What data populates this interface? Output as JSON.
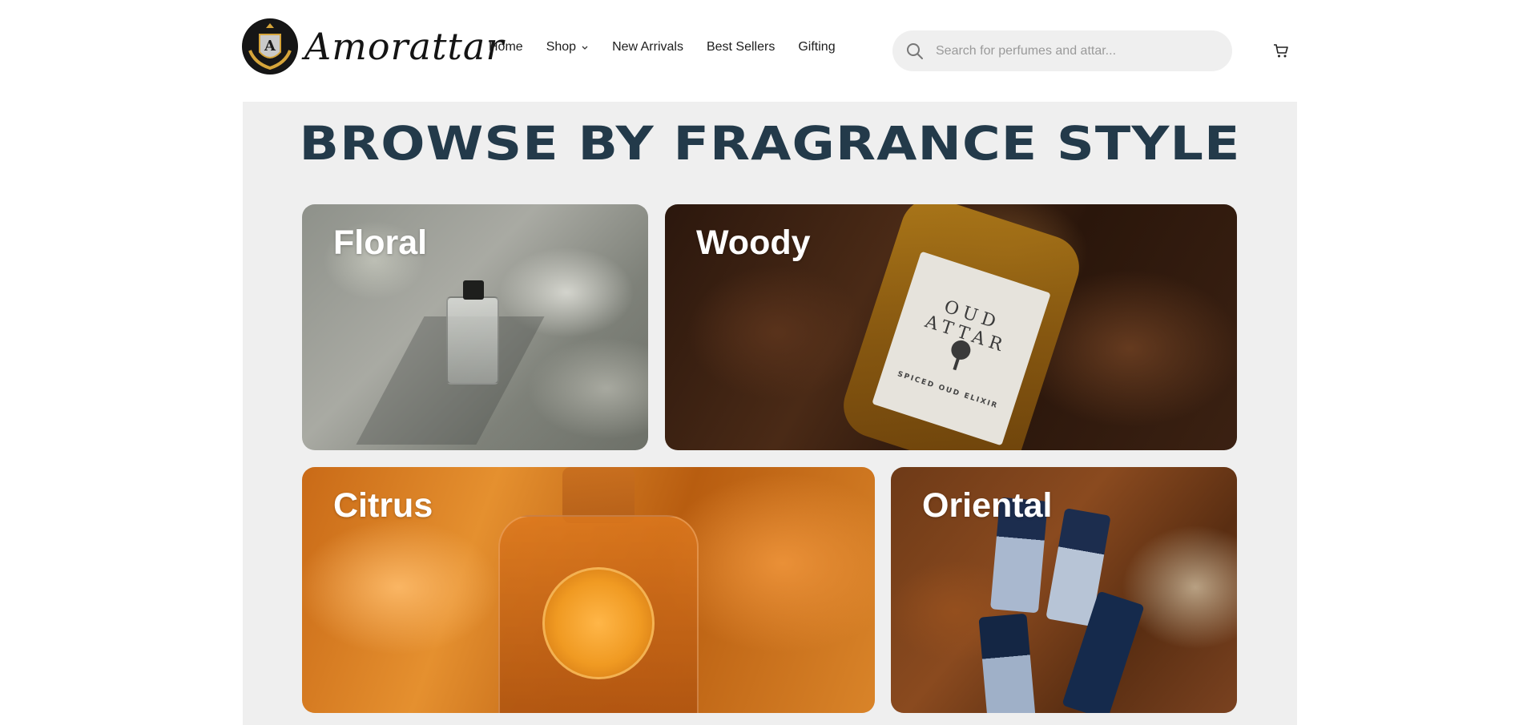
{
  "header": {
    "brand_name": "Amorattar",
    "brand_logo_icon": "crest-logo-icon",
    "nav": [
      {
        "label": "Home"
      },
      {
        "label": "Shop",
        "has_dropdown": true
      },
      {
        "label": "New Arrivals"
      },
      {
        "label": "Best Sellers"
      },
      {
        "label": "Gifting"
      }
    ],
    "search": {
      "placeholder": "Search for perfumes and attar...",
      "value": "",
      "icon": "search-icon"
    },
    "cart_icon": "cart-icon"
  },
  "section": {
    "title": "BROWSE BY FRAGRANCE STYLE",
    "title_color": "#233a4a",
    "background": "#efefef",
    "categories": [
      {
        "label": "Floral"
      },
      {
        "label": "Woody",
        "product_label": "OUD ATTAR",
        "product_sublabel": "SPICED OUD ELIXIR"
      },
      {
        "label": "Citrus"
      },
      {
        "label": "Oriental"
      }
    ]
  }
}
